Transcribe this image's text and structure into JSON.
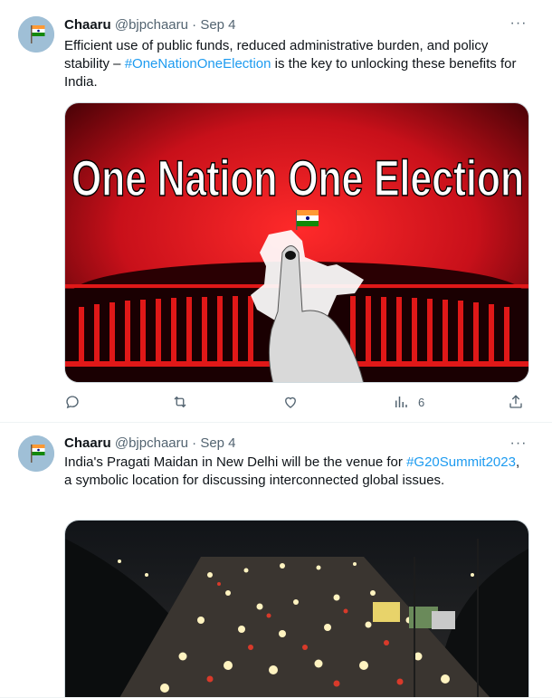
{
  "tweets": [
    {
      "name": "Chaaru",
      "handle": "@bjpchaaru",
      "separator": "·",
      "date": "Sep 4",
      "more_label": "···",
      "text_before": "Efficient use of public funds, reduced administrative burden, and policy stability – ",
      "hashtag": "#OneNationOneElection",
      "text_after": " is the key to unlocking these benefits for India.",
      "image_headline": "One Nation One Election",
      "actions": {
        "reply_count": "",
        "retweet_count": "",
        "like_count": "",
        "views_count": "6"
      }
    },
    {
      "name": "Chaaru",
      "handle": "@bjpchaaru",
      "separator": "·",
      "date": "Sep 4",
      "more_label": "···",
      "text_before": "India's Pragati Maidan in New Delhi will be the venue for ",
      "hashtag": "#G20Summit2023",
      "text_after": ", a symbolic location for discussing interconnected global issues."
    }
  ],
  "colors": {
    "link": "#1d9bf0",
    "secondary_text": "#536471",
    "image_red": "#c8101a"
  },
  "icons": [
    "reply-icon",
    "retweet-icon",
    "like-icon",
    "views-icon",
    "share-icon",
    "more-icon"
  ]
}
